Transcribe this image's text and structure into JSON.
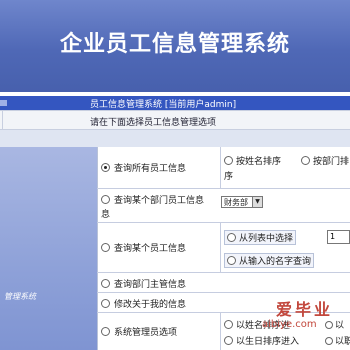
{
  "banner": {
    "title": "企业员工信息管理系统"
  },
  "header_bar": {
    "text": "员工信息管理系统 [当前用户admin]"
  },
  "prompt": {
    "text": "请在下面选择员工信息管理选项"
  },
  "sidebar": {
    "label": "管理系统"
  },
  "options": [
    {
      "label": "查询所有员工信息",
      "selected": true
    },
    {
      "label": "查询某个部门员工信息",
      "line2": "息",
      "selected": false
    },
    {
      "label": "查询某个员工信息",
      "selected": false
    },
    {
      "label": "查询部门主管信息",
      "selected": false
    },
    {
      "label": "修改关于我的信息",
      "selected": false
    },
    {
      "label": "系统管理员选项",
      "selected": false
    }
  ],
  "sort_options": {
    "by_name": "按姓名排序",
    "by_dept": "按部门排",
    "wrap": "序"
  },
  "dept_select": {
    "value": "财务部"
  },
  "employee_lookup": {
    "from_list": "从列表中选择",
    "from_name": "从输入的名字查询",
    "list_value": "1"
  },
  "admin_options": {
    "by_name": "以姓名排序进",
    "by_date": "以生日排序进入",
    "right_a": "以",
    "right_b": "以职"
  },
  "watermark": {
    "text": "爱毕业",
    "sub": "aibiye.com"
  }
}
